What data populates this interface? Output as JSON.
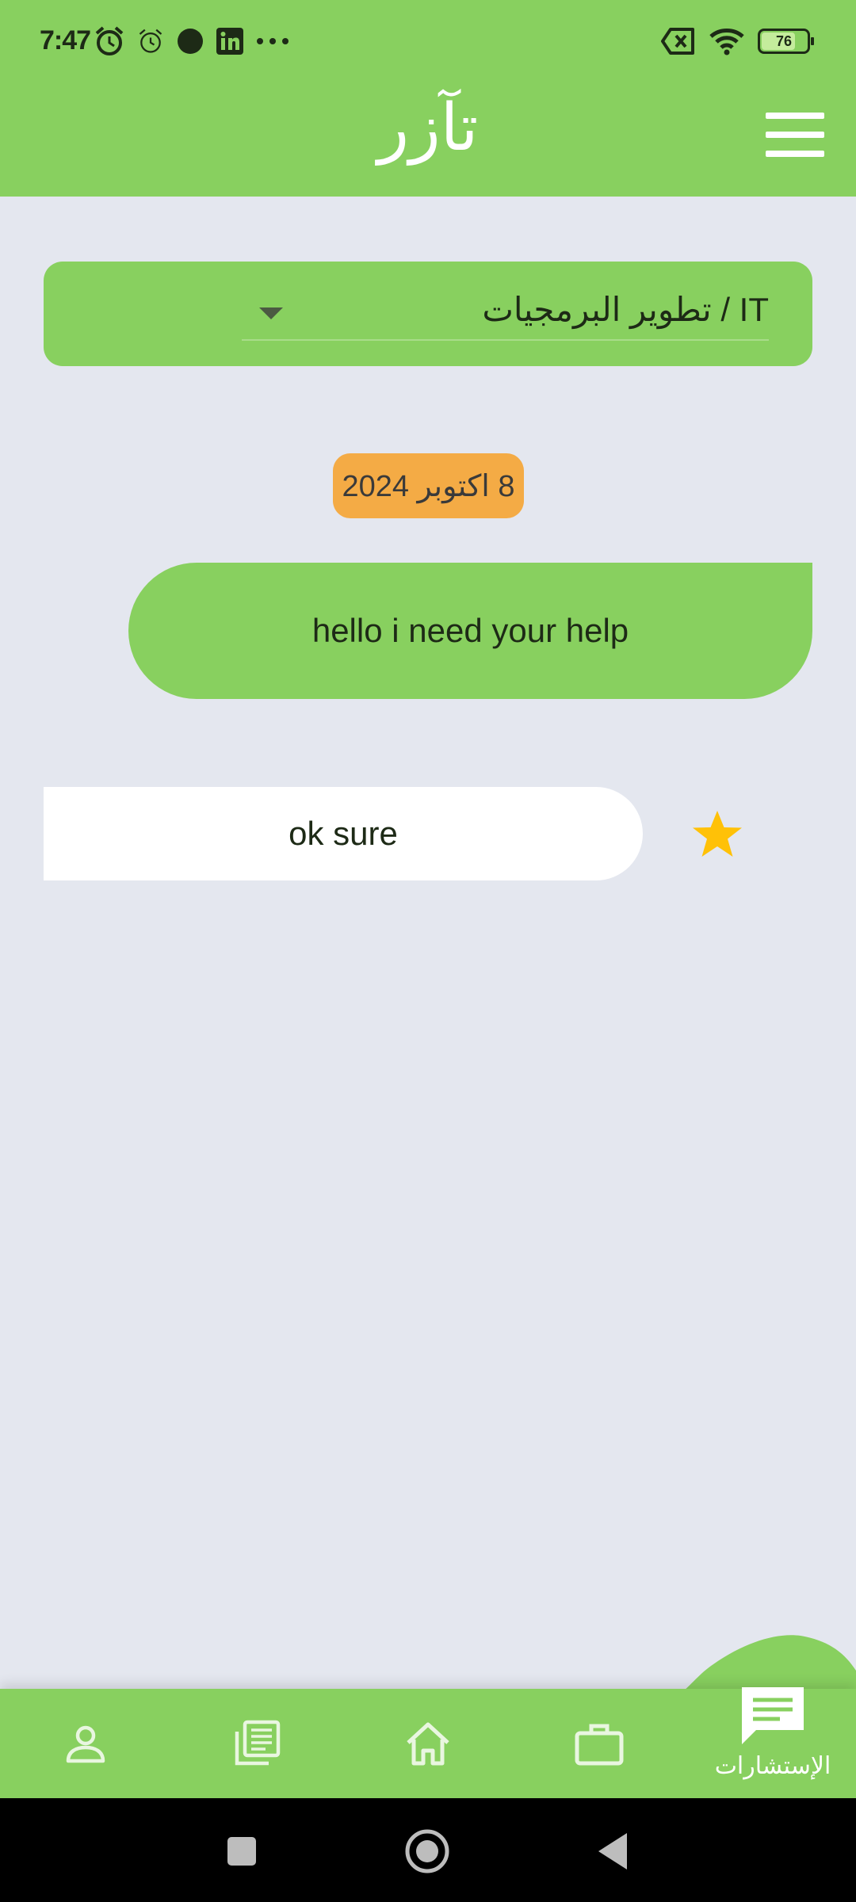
{
  "status_bar": {
    "time": "7:47",
    "battery_level": "76",
    "icons_left": [
      "alarm-clock-icon",
      "alarm-outline-icon",
      "dot-icon",
      "linkedin-icon",
      "more-dots-icon"
    ],
    "icons_right": [
      "no-sim-icon",
      "wifi-icon",
      "battery-icon"
    ]
  },
  "app_bar": {
    "title": "تآزر",
    "menu_icon": "hamburger-menu-icon"
  },
  "category": {
    "selected": "IT / تطوير البرمجيات"
  },
  "chat": {
    "date_label": "8 اكتوبر 2024",
    "messages": [
      {
        "direction": "sent",
        "text": "hello i need your help"
      },
      {
        "direction": "received",
        "text": "ok sure"
      }
    ],
    "star_icon": "star-icon"
  },
  "bottom_nav": {
    "items": [
      {
        "icon": "person-icon"
      },
      {
        "icon": "documents-icon"
      },
      {
        "icon": "home-icon"
      },
      {
        "icon": "briefcase-icon"
      },
      {
        "icon": "chat-icon",
        "label": "الإستشارات",
        "active": true
      }
    ]
  },
  "colors": {
    "primary_green": "#88d05f",
    "background": "#e4e7ef",
    "date_chip": "#f4ab45",
    "star": "#ffc107"
  }
}
